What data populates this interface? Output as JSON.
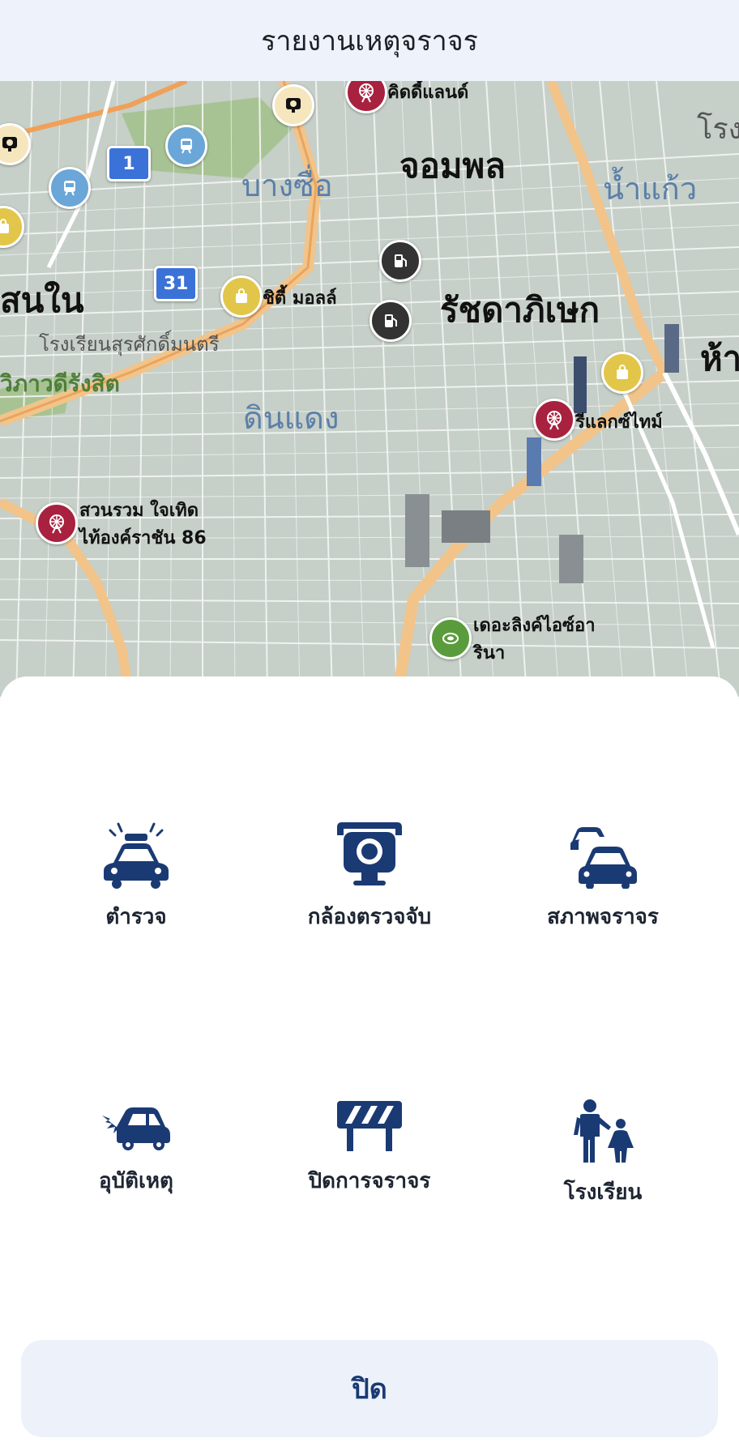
{
  "header": {
    "title": "รายงานเหตุจราจร"
  },
  "map": {
    "districts": [
      "จอมพล",
      "รัชดาภิเษก",
      "บางซื่อ",
      "น้ำแก้ว",
      "ดินแดง",
      "สนใน",
      "ห้า",
      "โรง"
    ],
    "places": [
      "คิดดี้แลนด์",
      "ชิตี้ มอลล์",
      "รีแลกซ์ไทม์",
      "สวนรวม ใจเทิด",
      "ไท้องค์ราชัน 86",
      "เดอะลิงค์ไอซ์อา",
      "รินา",
      "โรงเรียนสุรศักดิ์มนตรี",
      "วิภาวดีรังสิต"
    ],
    "route_shields": [
      "1",
      "31"
    ]
  },
  "actions": [
    {
      "label": "ตำรวจ",
      "icon": "police-car-icon"
    },
    {
      "label": "กล้องตรวจจับ",
      "icon": "speed-camera-icon"
    },
    {
      "label": "สภาพจราจร",
      "icon": "traffic-jam-icon"
    },
    {
      "label": "อุบัติเหตุ",
      "icon": "car-crash-icon"
    },
    {
      "label": "ปิดการจราจร",
      "icon": "road-closure-icon"
    },
    {
      "label": "โรงเรียน",
      "icon": "school-children-icon"
    }
  ],
  "close_button": {
    "label": "ปิด"
  },
  "colors": {
    "accent": "#1a3a73",
    "icon": "#1a3a73"
  }
}
